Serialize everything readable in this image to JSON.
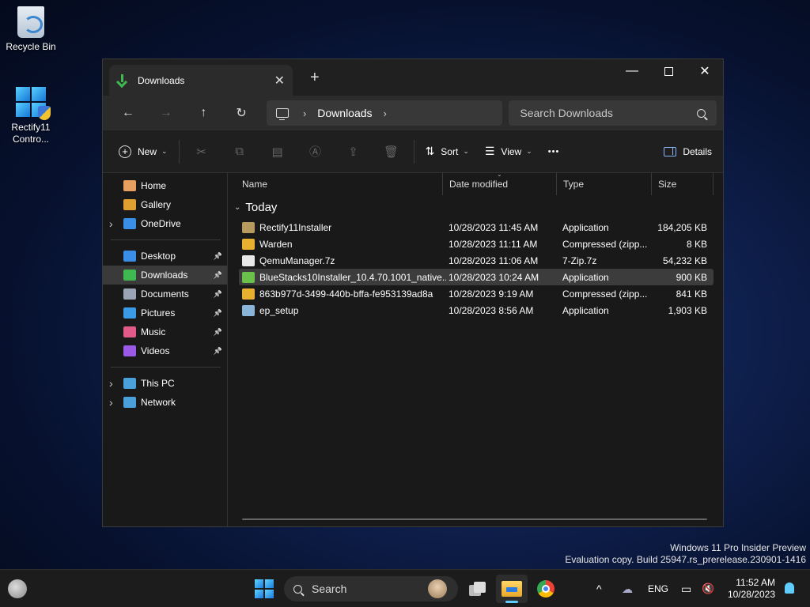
{
  "desktop": {
    "icons": [
      {
        "label": "Recycle Bin"
      },
      {
        "label": "Rectify11 Contro..."
      }
    ]
  },
  "window": {
    "tab_title": "Downloads",
    "controls": {
      "minimize": "—",
      "close": "✕"
    },
    "nav": {
      "back": "←",
      "forward": "→",
      "up": "↑",
      "refresh": "↻"
    },
    "breadcrumb": {
      "current": "Downloads",
      "sep": "›"
    },
    "search_placeholder": "Search Downloads",
    "commands": {
      "new": "New",
      "sort": "Sort",
      "view": "View",
      "more": "•••",
      "details": "Details"
    }
  },
  "nav_pane": {
    "group1": [
      {
        "label": "Home",
        "color": "#e8a060"
      },
      {
        "label": "Gallery",
        "color": "#e0a030"
      },
      {
        "label": "OneDrive",
        "color": "#3a8ee6",
        "expandable": true
      }
    ],
    "group2": [
      {
        "label": "Desktop",
        "color": "#3a8ee6",
        "pinned": true
      },
      {
        "label": "Downloads",
        "color": "#3fb950",
        "pinned": true,
        "selected": true
      },
      {
        "label": "Documents",
        "color": "#9aa4b4",
        "pinned": true
      },
      {
        "label": "Pictures",
        "color": "#3a9ae6",
        "pinned": true
      },
      {
        "label": "Music",
        "color": "#e05a8a",
        "pinned": true
      },
      {
        "label": "Videos",
        "color": "#9a5ae6",
        "pinned": true
      }
    ],
    "group3": [
      {
        "label": "This PC",
        "color": "#4aa0d8",
        "expandable": true
      },
      {
        "label": "Network",
        "color": "#4aa0d8",
        "expandable": true
      }
    ]
  },
  "columns": {
    "name": "Name",
    "date": "Date modified",
    "type": "Type",
    "size": "Size"
  },
  "group_label": "Today",
  "files": [
    {
      "name": "Rectify11Installer",
      "date": "10/28/2023 11:45 AM",
      "type": "Application",
      "size": "184,205 KB",
      "icon_color": "#b89a60"
    },
    {
      "name": "Warden",
      "date": "10/28/2023 11:11 AM",
      "type": "Compressed (zipp...",
      "size": "8 KB",
      "icon_color": "#e8b030"
    },
    {
      "name": "QemuManager.7z",
      "date": "10/28/2023 11:06 AM",
      "type": "7-Zip.7z",
      "size": "54,232 KB",
      "icon_color": "#e8e8e8"
    },
    {
      "name": "BlueStacks10Installer_10.4.70.1001_native...",
      "date": "10/28/2023 10:24 AM",
      "type": "Application",
      "size": "900 KB",
      "icon_color": "#6ac04a",
      "selected": true
    },
    {
      "name": "863b977d-3499-440b-bffa-fe953139ad8a",
      "date": "10/28/2023 9:19 AM",
      "type": "Compressed (zipp...",
      "size": "841 KB",
      "icon_color": "#e8b030"
    },
    {
      "name": "ep_setup",
      "date": "10/28/2023 8:56 AM",
      "type": "Application",
      "size": "1,903 KB",
      "icon_color": "#8ab4d8"
    }
  ],
  "watermark": {
    "line1": "Windows 11 Pro Insider Preview",
    "line2": "Evaluation copy. Build 25947.rs_prerelease.230901-1416"
  },
  "taskbar": {
    "search_label": "Search",
    "lang": "ENG",
    "time": "11:52 AM",
    "date": "10/28/2023",
    "chevron": "^"
  }
}
